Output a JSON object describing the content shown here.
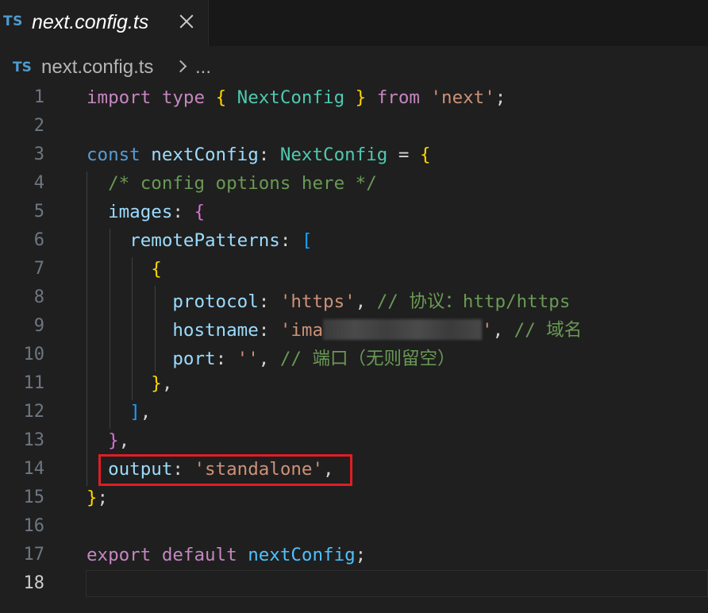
{
  "tab": {
    "icon": "TS",
    "title": "next.config.ts"
  },
  "breadcrumb": {
    "icon": "TS",
    "file": "next.config.ts",
    "more": "..."
  },
  "editor": {
    "active_line": 18,
    "lines": [
      {
        "number": "1"
      },
      {
        "number": "2"
      },
      {
        "number": "3"
      },
      {
        "number": "4"
      },
      {
        "number": "5"
      },
      {
        "number": "6"
      },
      {
        "number": "7"
      },
      {
        "number": "8"
      },
      {
        "number": "9"
      },
      {
        "number": "10"
      },
      {
        "number": "11"
      },
      {
        "number": "12"
      },
      {
        "number": "13"
      },
      {
        "number": "14"
      },
      {
        "number": "15"
      },
      {
        "number": "16"
      },
      {
        "number": "17"
      },
      {
        "number": "18"
      }
    ],
    "tokens": {
      "import": "import",
      "type": "type",
      "brace_open": "{",
      "brace_close": "}",
      "NextConfig": "NextConfig",
      "from": "from",
      "next_str": "'next'",
      "semicolon": ";",
      "const": "const",
      "nextConfig": "nextConfig",
      "colon": ":",
      "equals": "=",
      "comment_config": "/* config options here */",
      "images": "images",
      "remotePatterns": "remotePatterns",
      "bracket_open": "[",
      "bracket_close": "]",
      "protocol": "protocol",
      "https_str": "'https'",
      "comma": ",",
      "comment_protocol": "// 协议：http/https",
      "hostname": "hostname",
      "hostname_visible": "'ima",
      "hostname_end": "'",
      "comment_hostname": "// 域名",
      "port": "port",
      "empty_str": "''",
      "comment_port": "// 端口（无则留空）",
      "output": "output",
      "standalone_str": "'standalone'",
      "export": "export",
      "default": "default"
    }
  },
  "colors": {
    "background": "#1f1f1f",
    "keyword": "#c586c0",
    "storage": "#569cd6",
    "type": "#4ec9b0",
    "variable": "#9cdcfe",
    "string": "#ce9178",
    "comment": "#6a9955",
    "highlight_box": "#e11d24"
  }
}
